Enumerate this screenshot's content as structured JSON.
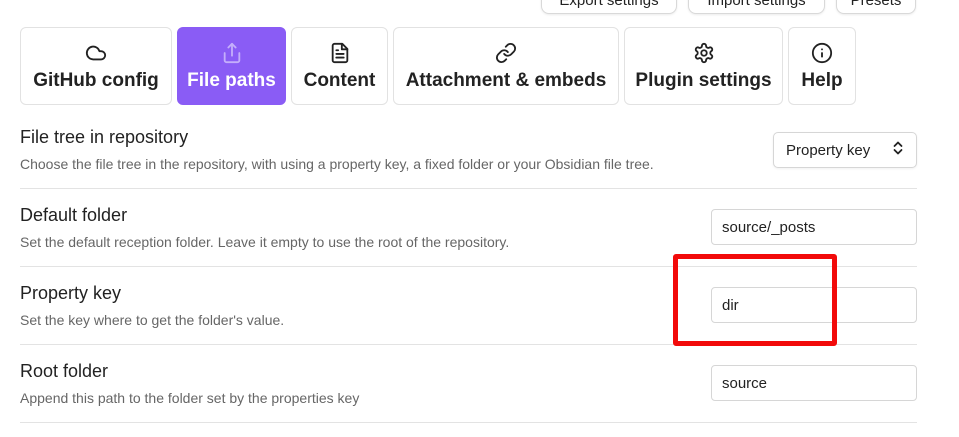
{
  "header_buttons": {
    "export_label": "Export settings",
    "import_label": "Import settings",
    "presets_label": "Presets"
  },
  "tabs": [
    {
      "label": "GitHub config",
      "icon": "cloud-icon"
    },
    {
      "label": "File paths",
      "icon": "upload-icon",
      "active": true
    },
    {
      "label": "Content",
      "icon": "file-text-icon"
    },
    {
      "label": "Attachment & embeds",
      "icon": "link-icon"
    },
    {
      "label": "Plugin settings",
      "icon": "gear-icon"
    },
    {
      "label": "Help",
      "icon": "info-icon"
    }
  ],
  "settings": {
    "file_tree": {
      "name": "File tree in repository",
      "description": "Choose the file tree in the repository, with using a property key, a fixed folder or your Obsidian file tree.",
      "selected": "Property key"
    },
    "default_folder": {
      "name": "Default folder",
      "description": "Set the default reception folder. Leave it empty to use the root of the repository.",
      "value": "source/_posts"
    },
    "property_key": {
      "name": "Property key",
      "description": "Set the key where to get the folder's value.",
      "value": "dir"
    },
    "root_folder": {
      "name": "Root folder",
      "description": "Append this path to the folder set by the properties key",
      "value": "source"
    }
  },
  "colors": {
    "accent": "#8a5cf5",
    "highlight": "#f20a0a"
  }
}
